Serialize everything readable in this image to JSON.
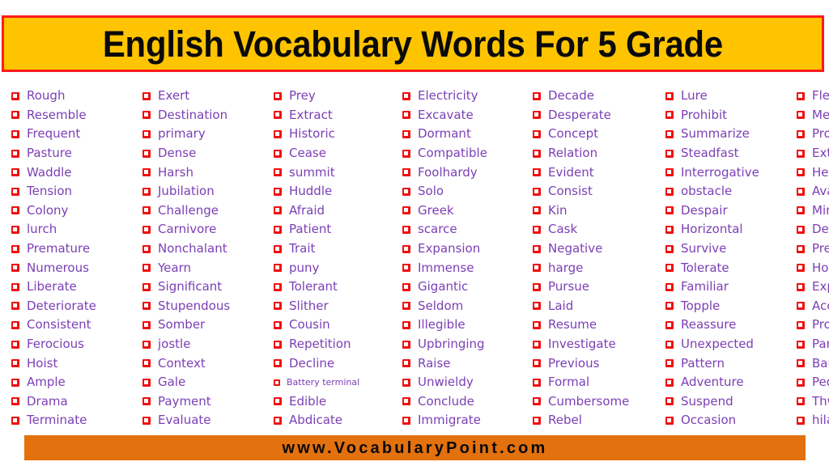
{
  "header": {
    "title": "English Vocabulary Words For 5 Grade",
    "background_color": "#FFC400",
    "border_color": "#FF1A1A",
    "text_color": "#0A0A0A"
  },
  "theme": {
    "word_color": "#7B3FB5",
    "checkbox_color": "#F01010",
    "footer_color": "#E2710E",
    "page_background": "#FFFFFF"
  },
  "columns": [
    {
      "index": 1,
      "items": [
        {
          "label": "Rough",
          "size": "normal"
        },
        {
          "label": "Resemble",
          "size": "normal"
        },
        {
          "label": "Frequent",
          "size": "normal"
        },
        {
          "label": "Pasture",
          "size": "normal"
        },
        {
          "label": "Waddle",
          "size": "normal"
        },
        {
          "label": "Tension",
          "size": "normal"
        },
        {
          "label": "Colony",
          "size": "normal"
        },
        {
          "label": "lurch",
          "size": "normal"
        },
        {
          "label": "Premature",
          "size": "normal"
        },
        {
          "label": "Numerous",
          "size": "normal"
        },
        {
          "label": "Liberate",
          "size": "normal"
        },
        {
          "label": "Deteriorate",
          "size": "normal"
        },
        {
          "label": "Consistent",
          "size": "normal"
        },
        {
          "label": "Ferocious",
          "size": "normal"
        },
        {
          "label": "Hoist",
          "size": "normal"
        },
        {
          "label": "Ample",
          "size": "normal"
        },
        {
          "label": "Drama",
          "size": "normal"
        },
        {
          "label": "Terminate",
          "size": "normal"
        }
      ]
    },
    {
      "index": 2,
      "items": [
        {
          "label": "Exert",
          "size": "normal"
        },
        {
          "label": "Destination",
          "size": "normal"
        },
        {
          "label": "primary",
          "size": "normal"
        },
        {
          "label": "Dense",
          "size": "normal"
        },
        {
          "label": "Harsh",
          "size": "normal"
        },
        {
          "label": "Jubilation",
          "size": "normal"
        },
        {
          "label": "Challenge",
          "size": "normal"
        },
        {
          "label": "Carnivore",
          "size": "normal"
        },
        {
          "label": "Nonchalant",
          "size": "normal"
        },
        {
          "label": "Yearn",
          "size": "normal"
        },
        {
          "label": "Significant",
          "size": "normal"
        },
        {
          "label": "Stupendous",
          "size": "normal"
        },
        {
          "label": "Somber",
          "size": "normal"
        },
        {
          "label": "jostle",
          "size": "normal"
        },
        {
          "label": "Context",
          "size": "normal"
        },
        {
          "label": "Gale",
          "size": "normal"
        },
        {
          "label": "Payment",
          "size": "normal"
        },
        {
          "label": "Evaluate",
          "size": "normal"
        }
      ]
    },
    {
      "index": 3,
      "items": [
        {
          "label": "Prey",
          "size": "normal"
        },
        {
          "label": "Extract",
          "size": "normal"
        },
        {
          "label": "Historic",
          "size": "normal"
        },
        {
          "label": "Cease",
          "size": "normal"
        },
        {
          "label": "summit",
          "size": "normal"
        },
        {
          "label": "Huddle",
          "size": "normal"
        },
        {
          "label": "Afraid",
          "size": "normal"
        },
        {
          "label": "Patient",
          "size": "normal"
        },
        {
          "label": "Trait",
          "size": "normal"
        },
        {
          "label": "puny",
          "size": "normal"
        },
        {
          "label": "Tolerant",
          "size": "normal"
        },
        {
          "label": "Slither",
          "size": "normal"
        },
        {
          "label": "Cousin",
          "size": "normal"
        },
        {
          "label": "Repetition",
          "size": "normal"
        },
        {
          "label": "Decline",
          "size": "normal"
        },
        {
          "label": "Battery terminal",
          "size": "small"
        },
        {
          "label": "Edible",
          "size": "normal"
        },
        {
          "label": "Abdicate",
          "size": "normal"
        }
      ]
    },
    {
      "index": 4,
      "items": [
        {
          "label": "Electricity",
          "size": "normal"
        },
        {
          "label": "Excavate",
          "size": "normal"
        },
        {
          "label": "Dormant",
          "size": "normal"
        },
        {
          "label": "Compatible",
          "size": "normal"
        },
        {
          "label": "Foolhardy",
          "size": "normal"
        },
        {
          "label": "Solo",
          "size": "normal"
        },
        {
          "label": "Greek",
          "size": "normal"
        },
        {
          "label": "scarce",
          "size": "normal"
        },
        {
          "label": "Expansion",
          "size": "normal"
        },
        {
          "label": "Immense",
          "size": "normal"
        },
        {
          "label": "Gigantic",
          "size": "normal"
        },
        {
          "label": "Seldom",
          "size": "normal"
        },
        {
          "label": "Illegible",
          "size": "normal"
        },
        {
          "label": "Upbringing",
          "size": "normal"
        },
        {
          "label": "Raise",
          "size": "normal"
        },
        {
          "label": "Unwieldy",
          "size": "normal"
        },
        {
          "label": "Conclude",
          "size": "normal"
        },
        {
          "label": "Immigrate",
          "size": "normal"
        }
      ]
    },
    {
      "index": 5,
      "items": [
        {
          "label": "Decade",
          "size": "normal"
        },
        {
          "label": "Desperate",
          "size": "normal"
        },
        {
          "label": "Concept",
          "size": "normal"
        },
        {
          "label": "Relation",
          "size": "normal"
        },
        {
          "label": "Evident",
          "size": "normal"
        },
        {
          "label": "Consist",
          "size": "normal"
        },
        {
          "label": "Kin",
          "size": "normal"
        },
        {
          "label": "Cask",
          "size": "normal"
        },
        {
          "label": "Negative",
          "size": "normal"
        },
        {
          "label": "harge",
          "size": "normal"
        },
        {
          "label": "Pursue",
          "size": "normal"
        },
        {
          "label": "Laid",
          "size": "normal"
        },
        {
          "label": "Resume",
          "size": "normal"
        },
        {
          "label": "Investigate",
          "size": "normal"
        },
        {
          "label": "Previous",
          "size": "normal"
        },
        {
          "label": "Formal",
          "size": "normal"
        },
        {
          "label": "Cumbersome",
          "size": "normal"
        },
        {
          "label": "Rebel",
          "size": "normal"
        }
      ]
    },
    {
      "index": 6,
      "items": [
        {
          "label": "Lure",
          "size": "normal"
        },
        {
          "label": "Prohibit",
          "size": "normal"
        },
        {
          "label": "Summarize",
          "size": "normal"
        },
        {
          "label": "Steadfast",
          "size": "normal"
        },
        {
          "label": "Interrogative",
          "size": "normal"
        },
        {
          "label": "obstacle",
          "size": "normal"
        },
        {
          "label": "Despair",
          "size": "normal"
        },
        {
          "label": "Horizontal",
          "size": "normal"
        },
        {
          "label": "Survive",
          "size": "normal"
        },
        {
          "label": "Tolerate",
          "size": "normal"
        },
        {
          "label": "Familiar",
          "size": "normal"
        },
        {
          "label": "Topple",
          "size": "normal"
        },
        {
          "label": "Reassure",
          "size": "normal"
        },
        {
          "label": "Unexpected",
          "size": "normal"
        },
        {
          "label": "Pattern",
          "size": "normal"
        },
        {
          "label": "Adventure",
          "size": "normal"
        },
        {
          "label": "Suspend",
          "size": "normal"
        },
        {
          "label": "Occasion",
          "size": "normal"
        }
      ]
    },
    {
      "index": 7,
      "items": [
        {
          "label": "Flee",
          "size": "normal"
        },
        {
          "label": "Meddle",
          "size": "normal"
        },
        {
          "label": "Prose",
          "size": "normal"
        },
        {
          "label": "Extinct",
          "size": "normal"
        },
        {
          "label": "Hesitate",
          "size": "normal"
        },
        {
          "label": "Avalanche",
          "size": "normal"
        },
        {
          "label": "Mimic",
          "size": "normal"
        },
        {
          "label": "Decade",
          "size": "normal"
        },
        {
          "label": "Predict",
          "size": "normal"
        },
        {
          "label": "Horizon",
          "size": "normal"
        },
        {
          "label": "Expand",
          "size": "normal"
        },
        {
          "label": "Access",
          "size": "normal"
        },
        {
          "label": "Provide",
          "size": "normal"
        },
        {
          "label": "Pamphlet",
          "size": "normal"
        },
        {
          "label": "Banquet",
          "size": "normal"
        },
        {
          "label": "Pedestrian",
          "size": "normal"
        },
        {
          "label": "Thwart",
          "size": "normal"
        },
        {
          "label": "hilarious",
          "size": "normal"
        }
      ]
    }
  ],
  "footer": {
    "website": "www.VocabularyPoint.com"
  }
}
